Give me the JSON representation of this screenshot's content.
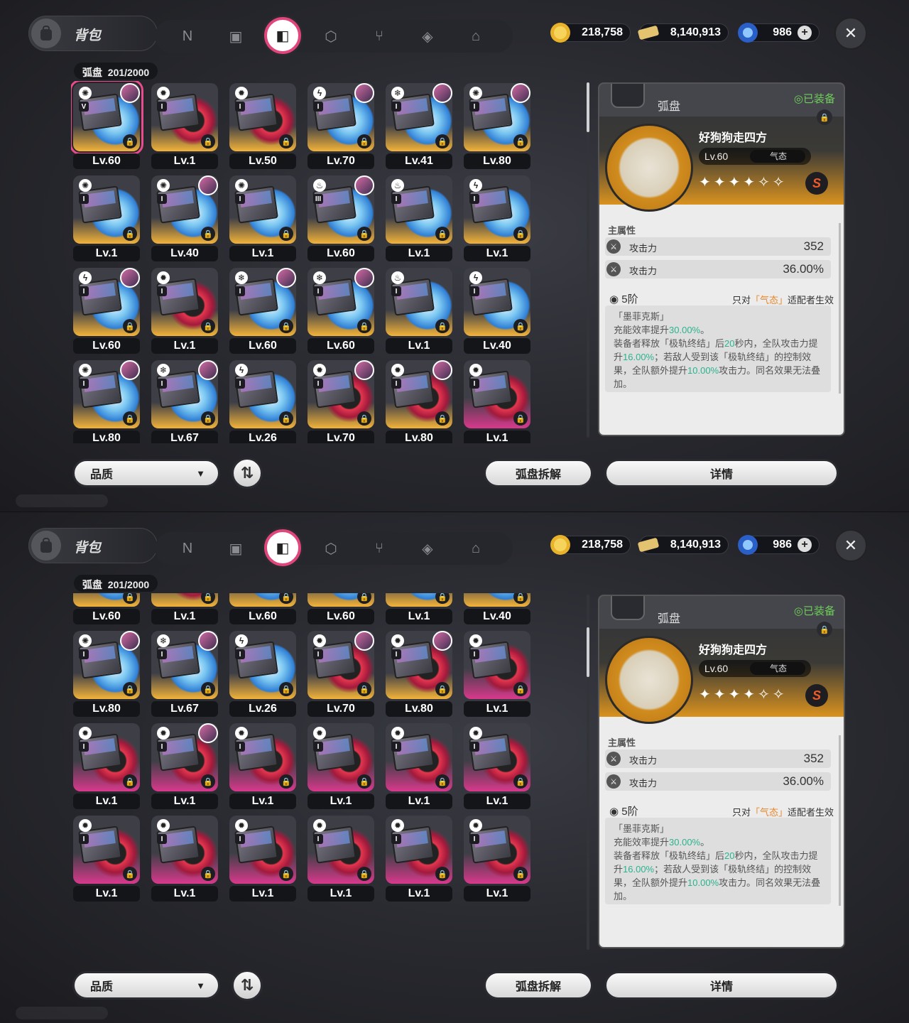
{
  "header": {
    "title": "背包",
    "tabs": [
      "network-icon",
      "gameboy-icon",
      "disc-icon",
      "cube-icon",
      "cutlery-icon",
      "bangboo-icon",
      "home-icon"
    ],
    "active_tab": 2
  },
  "currencies": [
    {
      "name": "dennies-icon",
      "value": "218,758"
    },
    {
      "name": "ticket-icon",
      "value": "8,140,913"
    },
    {
      "name": "polychrome-icon",
      "value": "986"
    }
  ],
  "close_label": "✕",
  "inventory": {
    "label": "弧盘",
    "count": "201/2000"
  },
  "discs_panel1": [
    {
      "lv": "Lv.60",
      "attr": "ether",
      "slot": "V",
      "avatar": true,
      "color": "gold",
      "disc": "blue",
      "selected": true
    },
    {
      "lv": "Lv.1",
      "attr": "physical",
      "slot": "I",
      "avatar": false,
      "color": "gold",
      "disc": "red"
    },
    {
      "lv": "Lv.50",
      "attr": "physical",
      "slot": "I",
      "avatar": false,
      "color": "gold",
      "disc": "red"
    },
    {
      "lv": "Lv.70",
      "attr": "electric",
      "slot": "I",
      "avatar": true,
      "color": "gold",
      "disc": "blue"
    },
    {
      "lv": "Lv.41",
      "attr": "ice",
      "slot": "I",
      "avatar": true,
      "color": "gold",
      "disc": "blue"
    },
    {
      "lv": "Lv.80",
      "attr": "ether",
      "slot": "I",
      "avatar": true,
      "color": "gold",
      "disc": "blue"
    },
    {
      "lv": "Lv.1",
      "attr": "ether",
      "slot": "I",
      "avatar": false,
      "color": "gold",
      "disc": "blue"
    },
    {
      "lv": "Lv.40",
      "attr": "ether",
      "slot": "I",
      "avatar": true,
      "color": "gold",
      "disc": "blue"
    },
    {
      "lv": "Lv.1",
      "attr": "ether",
      "slot": "I",
      "avatar": false,
      "color": "gold",
      "disc": "blue"
    },
    {
      "lv": "Lv.60",
      "attr": "fire",
      "slot": "III",
      "avatar": true,
      "color": "gold",
      "disc": "blue"
    },
    {
      "lv": "Lv.1",
      "attr": "fire",
      "slot": "I",
      "avatar": false,
      "color": "gold",
      "disc": "blue"
    },
    {
      "lv": "Lv.1",
      "attr": "electric",
      "slot": "I",
      "avatar": false,
      "color": "gold",
      "disc": "blue"
    },
    {
      "lv": "Lv.60",
      "attr": "electric",
      "slot": "I",
      "avatar": true,
      "color": "gold",
      "disc": "blue"
    },
    {
      "lv": "Lv.1",
      "attr": "physical",
      "slot": "I",
      "avatar": false,
      "color": "gold",
      "disc": "red"
    },
    {
      "lv": "Lv.60",
      "attr": "ice",
      "slot": "I",
      "avatar": true,
      "color": "gold",
      "disc": "blue"
    },
    {
      "lv": "Lv.60",
      "attr": "ice",
      "slot": "I",
      "avatar": true,
      "color": "gold",
      "disc": "blue"
    },
    {
      "lv": "Lv.1",
      "attr": "fire",
      "slot": "I",
      "avatar": false,
      "color": "gold",
      "disc": "blue"
    },
    {
      "lv": "Lv.40",
      "attr": "electric",
      "slot": "I",
      "avatar": false,
      "color": "gold",
      "disc": "blue"
    },
    {
      "lv": "Lv.80",
      "attr": "ether",
      "slot": "I",
      "avatar": true,
      "color": "gold",
      "disc": "blue"
    },
    {
      "lv": "Lv.67",
      "attr": "ice",
      "slot": "I",
      "avatar": true,
      "color": "gold",
      "disc": "blue"
    },
    {
      "lv": "Lv.26",
      "attr": "electric",
      "slot": "I",
      "avatar": false,
      "color": "gold",
      "disc": "blue"
    },
    {
      "lv": "Lv.70",
      "attr": "physical",
      "slot": "I",
      "avatar": true,
      "color": "gold",
      "disc": "red"
    },
    {
      "lv": "Lv.80",
      "attr": "physical",
      "slot": "I",
      "avatar": true,
      "color": "gold",
      "disc": "red"
    },
    {
      "lv": "Lv.1",
      "attr": "physical",
      "slot": "I",
      "avatar": false,
      "color": "pink",
      "disc": "red"
    }
  ],
  "discs_panel2": [
    {
      "lv": "Lv.60",
      "attr": "electric",
      "slot": "I",
      "avatar": false,
      "color": "gold",
      "disc": "blue"
    },
    {
      "lv": "Lv.1",
      "attr": "physical",
      "slot": "I",
      "avatar": false,
      "color": "gold",
      "disc": "red"
    },
    {
      "lv": "Lv.60",
      "attr": "ice",
      "slot": "I",
      "avatar": false,
      "color": "gold",
      "disc": "blue"
    },
    {
      "lv": "Lv.60",
      "attr": "ice",
      "slot": "I",
      "avatar": false,
      "color": "gold",
      "disc": "blue"
    },
    {
      "lv": "Lv.1",
      "attr": "fire",
      "slot": "I",
      "avatar": false,
      "color": "gold",
      "disc": "blue"
    },
    {
      "lv": "Lv.40",
      "attr": "electric",
      "slot": "I",
      "avatar": false,
      "color": "gold",
      "disc": "blue"
    },
    {
      "lv": "Lv.80",
      "attr": "ether",
      "slot": "I",
      "avatar": true,
      "color": "gold",
      "disc": "blue"
    },
    {
      "lv": "Lv.67",
      "attr": "ice",
      "slot": "I",
      "avatar": true,
      "color": "gold",
      "disc": "blue"
    },
    {
      "lv": "Lv.26",
      "attr": "electric",
      "slot": "I",
      "avatar": false,
      "color": "gold",
      "disc": "blue"
    },
    {
      "lv": "Lv.70",
      "attr": "physical",
      "slot": "I",
      "avatar": true,
      "color": "gold",
      "disc": "red"
    },
    {
      "lv": "Lv.80",
      "attr": "physical",
      "slot": "I",
      "avatar": true,
      "color": "gold",
      "disc": "red"
    },
    {
      "lv": "Lv.1",
      "attr": "physical",
      "slot": "I",
      "avatar": false,
      "color": "pink",
      "disc": "red"
    },
    {
      "lv": "Lv.1",
      "attr": "physical",
      "slot": "I",
      "avatar": false,
      "color": "pink",
      "disc": "red"
    },
    {
      "lv": "Lv.1",
      "attr": "physical",
      "slot": "I",
      "avatar": true,
      "color": "pink",
      "disc": "red"
    },
    {
      "lv": "Lv.1",
      "attr": "physical",
      "slot": "I",
      "avatar": false,
      "color": "pink",
      "disc": "red"
    },
    {
      "lv": "Lv.1",
      "attr": "physical",
      "slot": "I",
      "avatar": false,
      "color": "pink",
      "disc": "red"
    },
    {
      "lv": "Lv.1",
      "attr": "physical",
      "slot": "I",
      "avatar": false,
      "color": "pink",
      "disc": "red"
    },
    {
      "lv": "Lv.1",
      "attr": "physical",
      "slot": "I",
      "avatar": false,
      "color": "pink",
      "disc": "red"
    },
    {
      "lv": "Lv.1",
      "attr": "physical",
      "slot": "I",
      "avatar": false,
      "color": "pink",
      "disc": "red"
    },
    {
      "lv": "Lv.1",
      "attr": "physical",
      "slot": "I",
      "avatar": false,
      "color": "pink",
      "disc": "red"
    },
    {
      "lv": "Lv.1",
      "attr": "physical",
      "slot": "I",
      "avatar": false,
      "color": "pink",
      "disc": "red"
    },
    {
      "lv": "Lv.1",
      "attr": "physical",
      "slot": "I",
      "avatar": false,
      "color": "pink",
      "disc": "red"
    },
    {
      "lv": "Lv.1",
      "attr": "physical",
      "slot": "I",
      "avatar": false,
      "color": "pink",
      "disc": "red"
    },
    {
      "lv": "Lv.1",
      "attr": "physical",
      "slot": "I",
      "avatar": false,
      "color": "pink",
      "disc": "red"
    }
  ],
  "detail": {
    "category": "弧盘",
    "equipped": "◎已装备",
    "name": "好狗狗走四方",
    "level": "Lv.60",
    "tag": "气态",
    "stars": "✦✦✦✦✧✧",
    "rank": "S",
    "main_attr_label": "主属性",
    "stats": [
      {
        "name": "攻击力",
        "value": "352"
      },
      {
        "name": "攻击力",
        "value": "36.00%"
      }
    ],
    "tier": "5阶",
    "effect_prefix": "只对",
    "effect_tag": "「气态」",
    "effect_suffix": "适配者生效",
    "desc": {
      "title": "「墨菲克斯」",
      "line1a": "充能效率提升",
      "line1b": "30.00%",
      "line1c": "。",
      "line2a": "装备者释放「极轨终结」后",
      "line2b": "20",
      "line2c": "秒内，全队攻击力提升",
      "line3a": "16.00%",
      "line3b": "；若敌人受到该「极轨终结」的控制效果，全队额外提升",
      "line4a": "10.00%",
      "line4b": "攻击力。同名效果无法叠加。"
    }
  },
  "buttons": {
    "filter": "品质",
    "filter_caret": "▼",
    "sort": "⇅",
    "dismantle": "弧盘拆解",
    "details": "详情"
  },
  "attr_icons": {
    "ether": "✺",
    "physical": "✹",
    "electric": "ϟ",
    "ice": "❄",
    "fire": "♨"
  }
}
